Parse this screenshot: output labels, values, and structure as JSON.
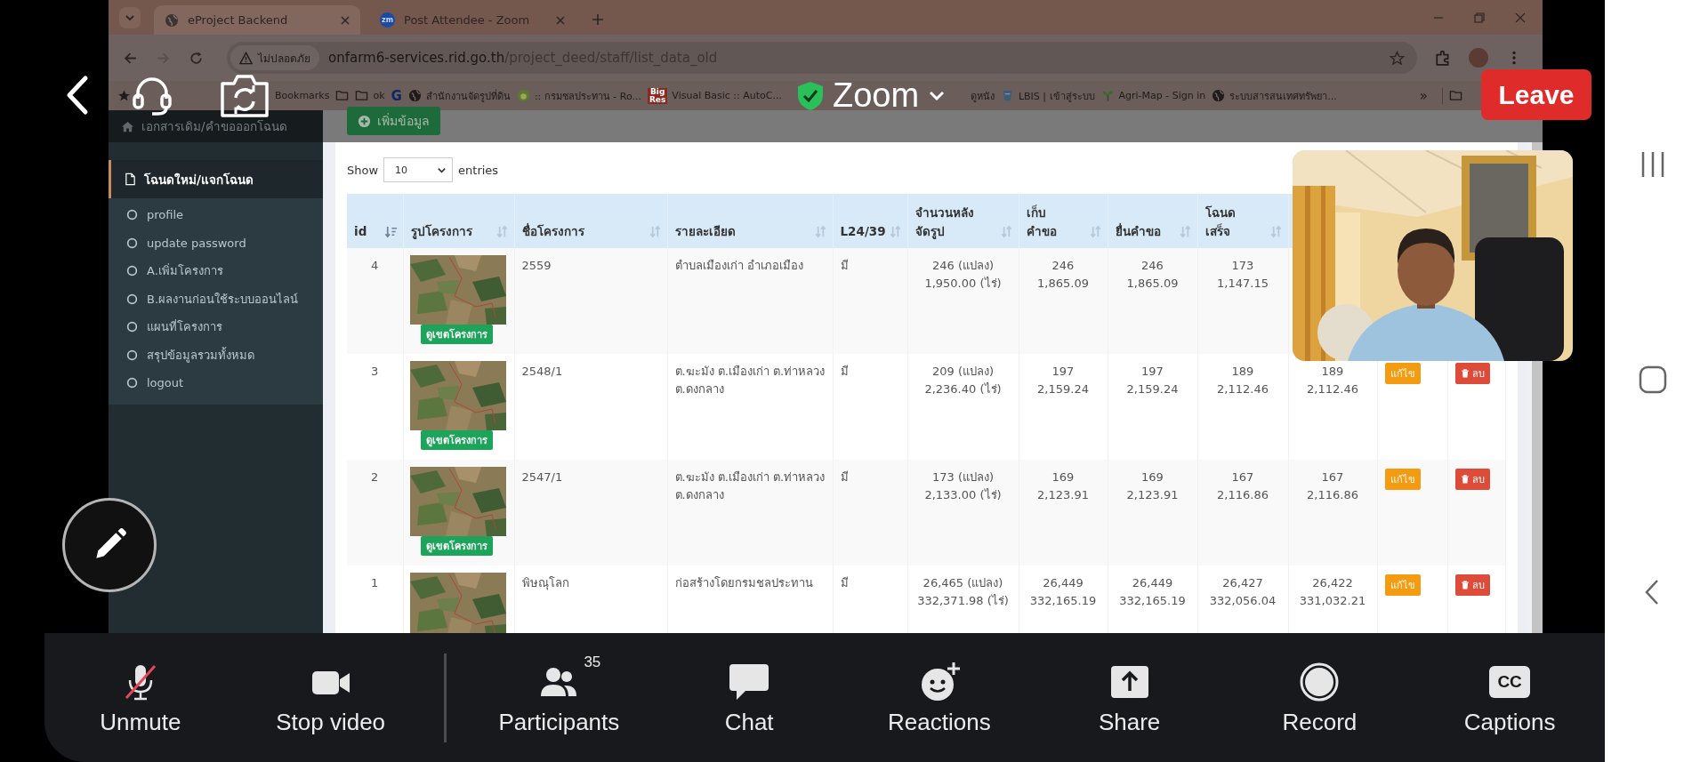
{
  "zoom": {
    "title": "Zoom",
    "leave": "Leave",
    "toolbar": [
      {
        "kind": "mic",
        "label": "Unmute",
        "muted": true
      },
      {
        "kind": "video",
        "label": "Stop video"
      },
      {
        "kind": "participants",
        "label": "Participants",
        "count": "35"
      },
      {
        "kind": "chat",
        "label": "Chat"
      },
      {
        "kind": "reactions",
        "label": "Reactions"
      },
      {
        "kind": "share",
        "label": "Share"
      },
      {
        "kind": "record",
        "label": "Record"
      },
      {
        "kind": "captions",
        "label": "Captions",
        "icon_text": "CC"
      }
    ]
  },
  "browser": {
    "tabs": [
      {
        "kind": "globe",
        "title": "eProject Backend",
        "selected": true
      },
      {
        "kind": "zoom",
        "icon_text": "zm",
        "title": "Post Attendee - Zoom",
        "selected": false
      }
    ],
    "address": {
      "security": "ไม่ปลอดภัย",
      "domain": "onfarm6-services.rid.go.th",
      "path": "/project_deed/staff/list_data_old"
    },
    "bookmarks": [
      {
        "kind": "star",
        "label": "Bookmarks"
      },
      {
        "kind": "folder"
      },
      {
        "kind": "folder",
        "label": "ok"
      },
      {
        "kind": "letter",
        "icon_text": "G"
      },
      {
        "kind": "globe",
        "label": "สำนักงานจัดรูปที่ดิน"
      },
      {
        "kind": "emblem",
        "label": ":: กรมชลประทาน - Ro..."
      },
      {
        "kind": "badge",
        "icon_text": "Big\nRes",
        "label": "Visual Basic :: AutoC..."
      },
      {
        "kind": "plain",
        "label": "ดูหนัง"
      },
      {
        "kind": "cup",
        "label": "LBIS | เข้าสู่ระบบ"
      },
      {
        "kind": "sprout",
        "label": "Agri-Map - Sign in"
      },
      {
        "kind": "globe",
        "label": "ระบบสารสนเทศทรัพยา..."
      },
      {
        "kind": "more",
        "icon_text": "»"
      },
      {
        "kind": "folder"
      }
    ]
  },
  "sidebar": {
    "header": "เอกสารเดิม/คำขอออกโฉนด",
    "section": {
      "label": "โฉนดใหม่/แจกโฉนด",
      "expanded": true
    },
    "items": [
      "profile",
      "update password",
      "A.เพิ่มโครงการ",
      "B.ผลงานก่อนใช้ระบบออนไลน์",
      "แผนที่โครงการ",
      "สรุปข้อมูลรวมทั้งหมด",
      "logout"
    ]
  },
  "page": {
    "add_button": "เพิ่มข้อมูล",
    "length": {
      "before": "Show",
      "value": "10",
      "after": "entries"
    }
  },
  "table": {
    "columns": [
      {
        "label": "id",
        "sorted": true
      },
      {
        "label": "รูปโครงการ",
        "sorted": false
      },
      {
        "label": "ชื่อโครงการ",
        "sorted": false
      },
      {
        "label": "รายละเอียด",
        "sorted": false
      },
      {
        "label": "L24/39",
        "sorted": false
      },
      {
        "label": "จำนวนหลัง\nจัดรูป",
        "sorted": false
      },
      {
        "label": "เก็บ\nคำขอ",
        "sorted": false
      },
      {
        "label": "ยื่นคำขอ",
        "sorted": false
      },
      {
        "label": "โฉนด\nเสร็จ",
        "sorted": false
      }
    ],
    "rows": [
      {
        "id": "4",
        "view_button": "ดูเขตโครงการ",
        "name": "2559",
        "detail": "ตำบลเมืองเก่า อำเภอเมือง",
        "l24_39": "มี",
        "plots": "246 (แปลง)\n1,950.00 (ไร่)",
        "collected": "246\n1,865.09",
        "submitted": "246\n1,865.09",
        "completed": "173\n1,147.15"
      },
      {
        "id": "3",
        "view_button": "ดูเขตโครงการ",
        "name": "2548/1",
        "detail": "ต.ฆะมัง ต.เมืองเก่า ต.ท่าหลวง ต.ดงกลาง",
        "l24_39": "มี",
        "plots": "209 (แปลง)\n2,236.40 (ไร่)",
        "collected": "197\n2,159.24",
        "submitted": "197\n2,159.24",
        "completed": "189\n2,112.46",
        "column_10": "189\n2,112.46",
        "edit": "แก้ไข",
        "delete": "ลบ"
      },
      {
        "id": "2",
        "view_button": "ดูเขตโครงการ",
        "name": "2547/1",
        "detail": "ต.ฆะมัง ต.เมืองเก่า ต.ท่าหลวง ต.ดงกลาง",
        "l24_39": "มี",
        "plots": "173 (แปลง)\n2,133.00 (ไร่)",
        "collected": "169\n2,123.91",
        "submitted": "169\n2,123.91",
        "completed": "167\n2,116.86",
        "column_10": "167\n2,116.86",
        "edit": "แก้ไข",
        "delete": "ลบ"
      },
      {
        "id": "1",
        "name": "พิษณุโลก",
        "detail": "ก่อสร้างโดยกรมชลประทาน",
        "l24_39": "มี",
        "plots": "26,465 (แปลง)\n332,371.98 (ไร่)",
        "collected": "26,449\n332,165.19",
        "submitted": "26,449\n332,165.19",
        "completed": "26,427\n332,056.04",
        "column_10": "26,422\n331,032.21",
        "edit": "แก้ไข",
        "delete": "ลบ"
      }
    ]
  }
}
